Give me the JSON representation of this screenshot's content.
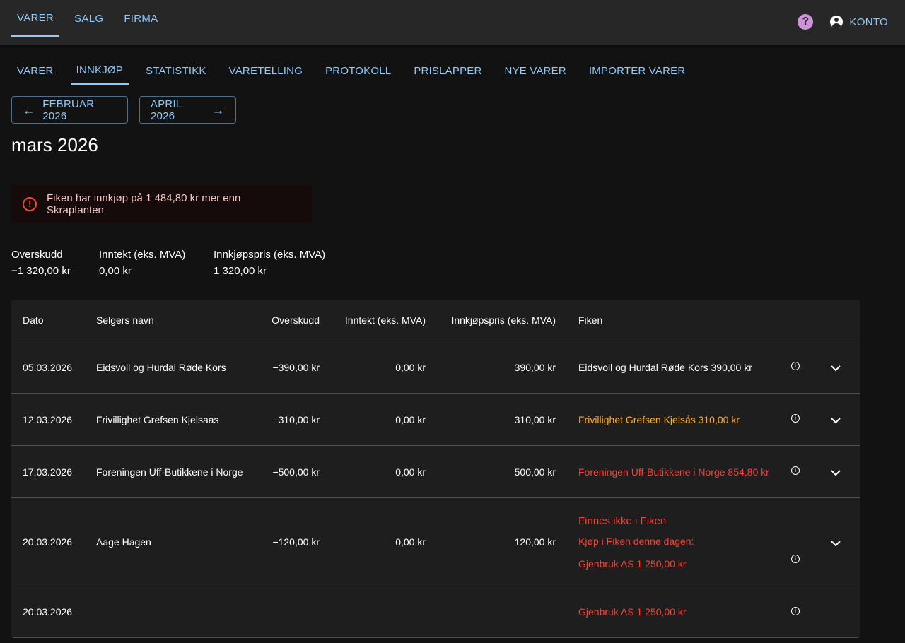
{
  "topnav": {
    "tabs": [
      {
        "label": "VARER",
        "active": true
      },
      {
        "label": "SALG",
        "active": false
      },
      {
        "label": "FIRMA",
        "active": false
      }
    ],
    "help_icon": "help-icon",
    "account_label": "KONTO"
  },
  "subnav": {
    "tabs": [
      {
        "label": "VARER",
        "active": false
      },
      {
        "label": "INNKJØP",
        "active": true
      },
      {
        "label": "STATISTIKK",
        "active": false
      },
      {
        "label": "VARETELLING",
        "active": false
      },
      {
        "label": "PROTOKOLL",
        "active": false
      },
      {
        "label": "PRISLAPPER",
        "active": false
      },
      {
        "label": "NYE VARER",
        "active": false
      },
      {
        "label": "IMPORTER VARER",
        "active": false
      }
    ]
  },
  "month_nav": {
    "prev_label": "FEBRUAR 2026",
    "next_label": "APRIL 2026"
  },
  "page_title": "mars 2026",
  "alert": {
    "text": "Fiken har innkjøp på 1 484,80 kr mer enn Skrapfanten",
    "icon": "error-icon"
  },
  "summary": {
    "overskudd_label": "Overskudd",
    "overskudd_value": "−1 320,00 kr",
    "inntekt_label": "Inntekt (eks. MVA)",
    "inntekt_value": "0,00 kr",
    "innkjop_label": "Innkjøpspris (eks. MVA)",
    "innkjop_value": "1 320,00 kr"
  },
  "table": {
    "headers": {
      "dato": "Dato",
      "selger": "Selgers navn",
      "overskudd": "Overskudd",
      "inntekt": "Inntekt (eks. MVA)",
      "innkjop": "Innkjøpspris (eks. MVA)",
      "fiken": "Fiken"
    },
    "rows": [
      {
        "dato": "05.03.2026",
        "selger": "Eidsvoll og Hurdal Røde Kors",
        "overskudd": "−390,00 kr",
        "inntekt": "0,00 kr",
        "innkjop": "390,00 kr",
        "fiken": "Eidsvoll og Hurdal Røde Kors 390,00 kr",
        "status": "ok"
      },
      {
        "dato": "12.03.2026",
        "selger": "Frivillighet Grefsen Kjelsaas",
        "overskudd": "−310,00 kr",
        "inntekt": "0,00 kr",
        "innkjop": "310,00 kr",
        "fiken": "Frivillighet Grefsen Kjelsås 310,00 kr",
        "status": "warn"
      },
      {
        "dato": "17.03.2026",
        "selger": "Foreningen Uff-Butikkene i Norge",
        "overskudd": "−500,00 kr",
        "inntekt": "0,00 kr",
        "innkjop": "500,00 kr",
        "fiken": "Foreningen Uff-Butikkene i Norge 854,80 kr",
        "status": "err"
      },
      {
        "dato": "20.03.2026",
        "selger": "Aage Hagen",
        "overskudd": "−120,00 kr",
        "inntekt": "0,00 kr",
        "innkjop": "120,00 kr",
        "fiken_missing": "Finnes ikke i Fiken",
        "fiken_same_day": "Kjøp i Fiken denne dagen:",
        "fiken": "Gjenbruk AS 1 250,00 kr",
        "status": "err"
      },
      {
        "dato": "20.03.2026",
        "selger": "",
        "overskudd": "",
        "inntekt": "",
        "innkjop": "",
        "fiken": "Gjenbruk AS 1 250,00 kr",
        "status": "err"
      }
    ]
  },
  "colors": {
    "accent": "#90caf9",
    "warning": "#ffa726",
    "error": "#f44336",
    "help": "#ce93d8"
  }
}
